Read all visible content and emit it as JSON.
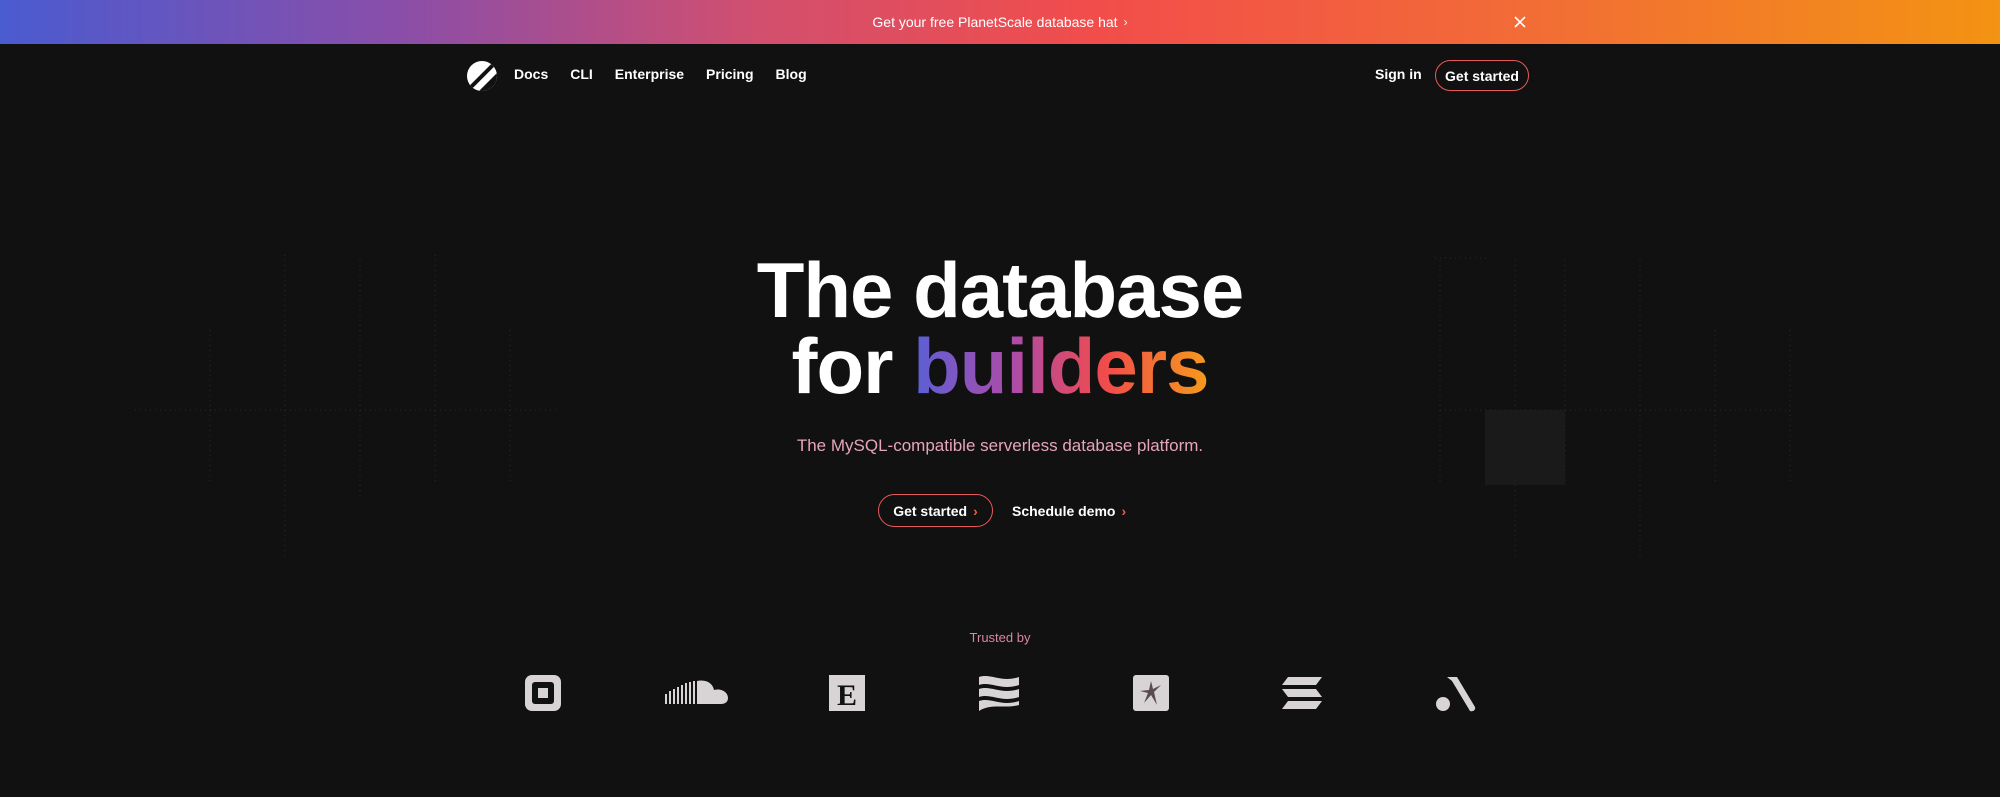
{
  "banner": {
    "text": "Get your free PlanetScale database hat",
    "chevron_icon": "chevron-right-icon",
    "close_icon": "close-icon"
  },
  "nav": {
    "logo_icon": "planetscale-logo-icon",
    "links": [
      "Docs",
      "CLI",
      "Enterprise",
      "Pricing",
      "Blog"
    ],
    "signin": "Sign in",
    "cta": "Get started"
  },
  "hero": {
    "title_line1": "The database",
    "title_line2_prefix": "for ",
    "title_line2_accent": "builders",
    "subtitle": "The MySQL-compatible serverless database platform.",
    "primary_cta": "Get started",
    "secondary_cta": "Schedule demo"
  },
  "trusted": {
    "label": "Trusted by",
    "logos": [
      "square-logo-icon",
      "soundcloud-logo-icon",
      "etsy-logo-icon",
      "wave-logo-icon",
      "jordan-logo-icon",
      "solana-logo-icon",
      "arrow-a-logo-icon"
    ]
  },
  "colors": {
    "background": "#111111",
    "accent_red": "#f14b4b",
    "accent_orange": "#f59b1c",
    "accent_purple": "#5b5fd6",
    "subtitle_pink": "#e6a5b8"
  }
}
